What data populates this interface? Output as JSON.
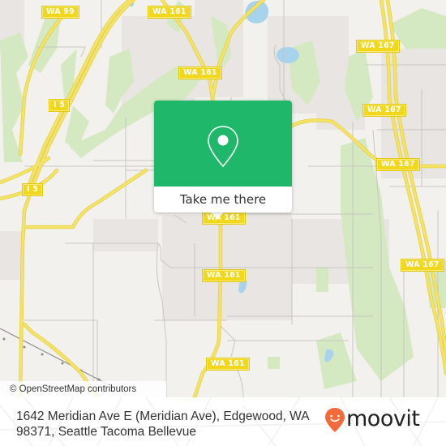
{
  "map": {
    "attribution": "© OpenStreetMap contributors",
    "colors": {
      "land": "#f2f1ed",
      "residential": "#e9e5e2",
      "park": "#d4e8c1",
      "water": "#a8d3ec",
      "highway": "#f4e36b",
      "highway_edge": "#e5cf3d",
      "minor_road": "#c8c6c3"
    },
    "road_labels": [
      {
        "id": "wa99-n",
        "text": "WA 99"
      },
      {
        "id": "wa161-n",
        "text": "WA 161"
      },
      {
        "id": "wa161-mid",
        "text": "WA 161"
      },
      {
        "id": "i5-a",
        "text": "I 5"
      },
      {
        "id": "i5-b",
        "text": "I 5"
      },
      {
        "id": "wa167-a",
        "text": "WA 167"
      },
      {
        "id": "wa167-b",
        "text": "WA 167"
      },
      {
        "id": "wa167-c",
        "text": "WA 167"
      },
      {
        "id": "wa167-d",
        "text": "WA 167"
      },
      {
        "id": "wa161-c",
        "text": "WA 161"
      },
      {
        "id": "wa161-d",
        "text": "WA 161"
      },
      {
        "id": "wa161-s",
        "text": "WA 161"
      }
    ]
  },
  "popup": {
    "icon": "map-pin-icon",
    "button_label": "Take me there",
    "color": "#1fb86a"
  },
  "footer": {
    "address_line1": "1642 Meridian Ave E (Meridian Ave), Edgewood, WA",
    "address_line2": "98371, Seattle Tacoma Bellevue",
    "brand": "moovit",
    "brand_icon": "moovit-pin-icon",
    "brand_color": "#f26b3a"
  }
}
